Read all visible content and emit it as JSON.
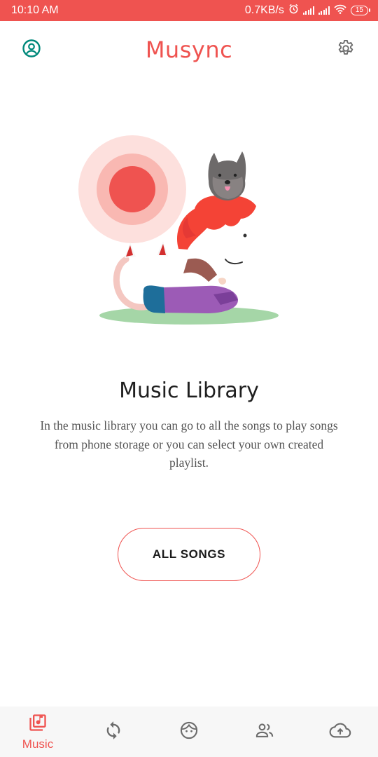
{
  "status_bar": {
    "time": "10:10 AM",
    "speed": "0.7KB/s",
    "battery": "15",
    "icons": [
      "alarm-icon",
      "signal-icon",
      "signal-icon",
      "wifi-icon",
      "battery-icon"
    ]
  },
  "header": {
    "title": "Musync",
    "left_icon": "account-circle-icon",
    "right_icon": "gear-icon"
  },
  "main": {
    "title": "Music Library",
    "description": "In the music library you can go to all the songs to play songs from phone storage or you can select your own created playlist.",
    "button_label": "ALL SONGS"
  },
  "bottom_nav": {
    "items": [
      {
        "label": "Music",
        "icon": "music-library-icon",
        "active": true
      },
      {
        "label": "",
        "icon": "sync-icon",
        "active": false
      },
      {
        "label": "",
        "icon": "face-icon",
        "active": false
      },
      {
        "label": "",
        "icon": "people-icon",
        "active": false
      },
      {
        "label": "",
        "icon": "cloud-upload-icon",
        "active": false
      }
    ]
  },
  "colors": {
    "accent": "#ef5350",
    "nav_icon": "#6b6b6b",
    "teal_icon": "#00897b"
  }
}
